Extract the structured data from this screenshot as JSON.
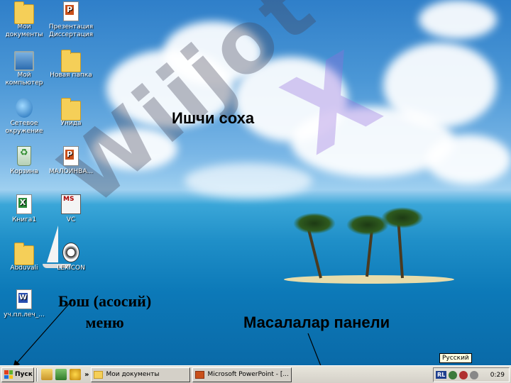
{
  "desktop": {
    "icons": [
      {
        "label": "Мои документы",
        "glyph": "folder-documents-icon"
      },
      {
        "label": "Презентация Диссертация",
        "glyph": "powerpoint-file-icon"
      },
      {
        "label": "Мой компьютер",
        "glyph": "computer-icon"
      },
      {
        "label": "Новая папка",
        "glyph": "folder-icon"
      },
      {
        "label": "Сетевое окружение",
        "glyph": "network-icon"
      },
      {
        "label": "Унида",
        "glyph": "folder-icon"
      },
      {
        "label": "Корзина",
        "glyph": "recycle-bin-icon"
      },
      {
        "label": "МАЛОИНВА...",
        "glyph": "powerpoint-file-icon"
      },
      {
        "label": "Книга1",
        "glyph": "excel-file-icon"
      },
      {
        "label": "VC",
        "glyph": "msvc-icon"
      },
      {
        "label": "Abduvali",
        "glyph": "folder-icon"
      },
      {
        "label": "LEXICON",
        "glyph": "lexicon-icon"
      },
      {
        "label": "уч.пл.леч_...",
        "glyph": "word-file-icon"
      }
    ]
  },
  "annotations": {
    "work_area": "Ишчи соха",
    "start_menu_line1": "Бош (асосий)",
    "start_menu_line2": "меню",
    "taskbar": "Масалалар панели"
  },
  "watermark": {
    "text": "Wiijot",
    "letter": "X"
  },
  "taskbar": {
    "start_label": "Пуск",
    "chevron": "»",
    "tasks": [
      {
        "label": "Мои документы",
        "icon": "folder-icon"
      },
      {
        "label": "Microsoft PowerPoint - [...",
        "icon": "powerpoint-icon"
      }
    ],
    "tray": {
      "language": "RL",
      "clock": "0:29",
      "tooltip": "Русский"
    }
  }
}
